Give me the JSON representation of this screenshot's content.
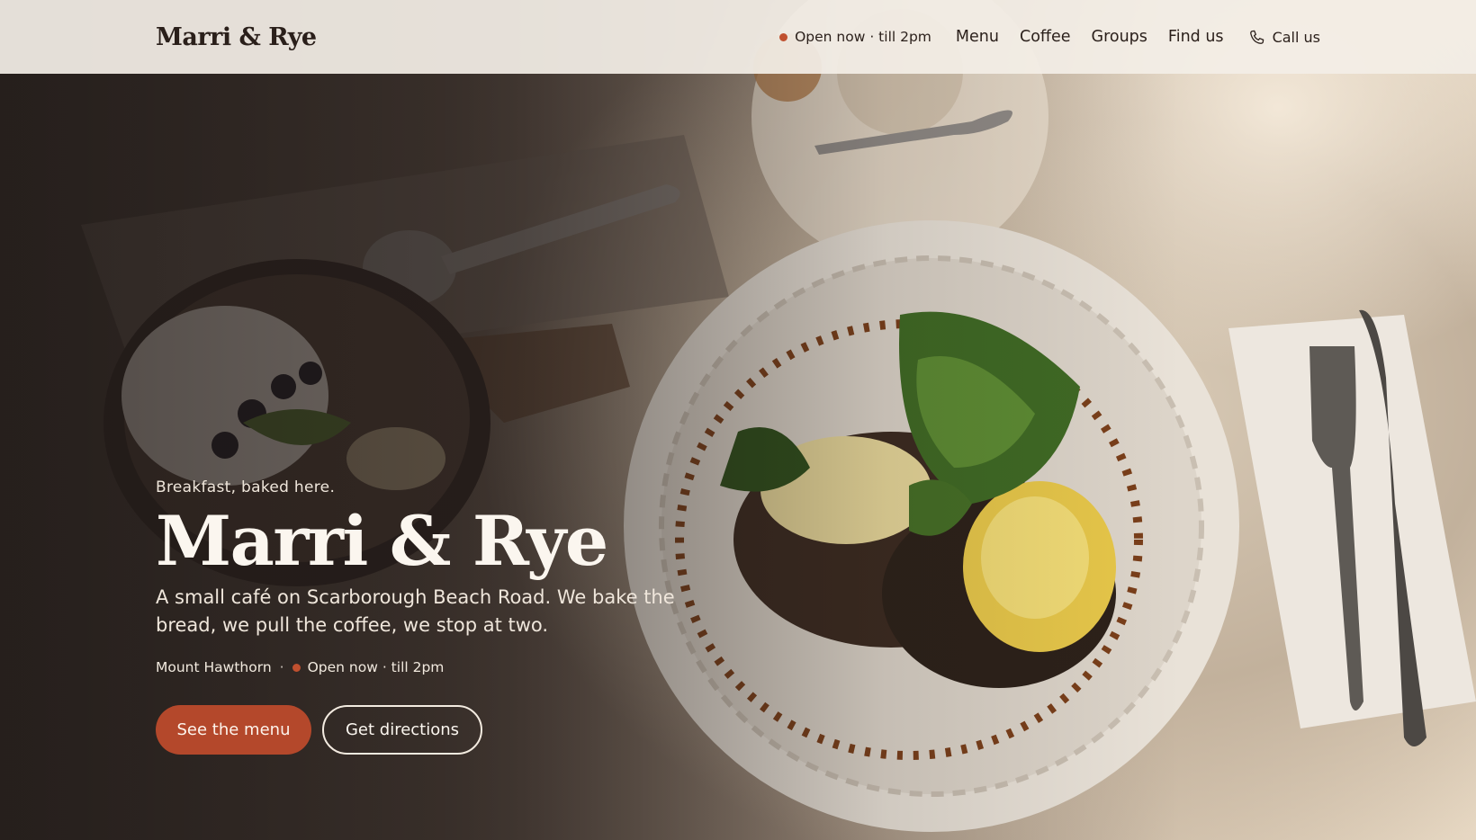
{
  "header": {
    "brand": "Marri & Rye",
    "status_text": "Open now · till 2pm",
    "nav": [
      "Menu",
      "Coffee",
      "Groups",
      "Find us"
    ],
    "call_label": "Call us"
  },
  "hero": {
    "eyebrow": "Breakfast, baked here.",
    "title": "Marri & Rye",
    "subtitle": "A small café on Scarborough Beach Road. We bake the bread, we pull the coffee, we stop at two.",
    "location": "Mount Hawthorn",
    "separator": "·",
    "status_text": "Open now · till 2pm",
    "primary_cta": "See the menu",
    "secondary_cta": "Get directions"
  },
  "colors": {
    "accent": "#b4482b",
    "status_dot": "#c0502f",
    "nav_bg": "#f3eee6",
    "ink": "#2a1f1a"
  },
  "icons": {
    "call": "phone-icon",
    "status": "status-dot-icon"
  }
}
